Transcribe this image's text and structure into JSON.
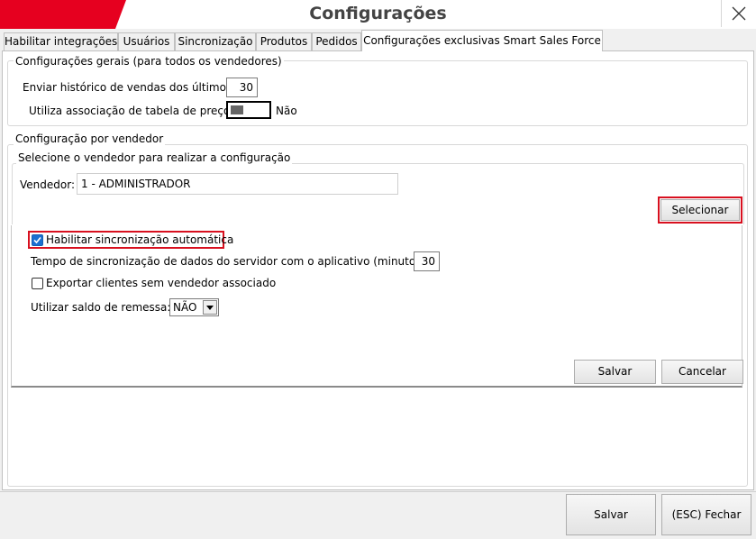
{
  "window": {
    "title": "Configurações",
    "close_icon": "close-icon"
  },
  "tabs": [
    {
      "label": "Habilitar integrações"
    },
    {
      "label": "Usuários"
    },
    {
      "label": "Sincronização"
    },
    {
      "label": "Produtos"
    },
    {
      "label": "Pedidos"
    },
    {
      "label": "Configurações exclusivas Smart Sales Force",
      "active": true
    }
  ],
  "general": {
    "legend": "Configurações gerais (para todos os vendedores)",
    "history_label": "Enviar histórico de vendas dos últimos:",
    "history_value": "30",
    "price_table_label": "Utiliza associação de tabela de preço:",
    "price_table_state": "Não"
  },
  "per_seller": {
    "legend": "Configuração por vendedor",
    "select_legend": "Selecione o vendedor para realizar a configuração",
    "seller_label": "Vendedor:",
    "seller_value": "1 - ADMINISTRADOR",
    "select_button": "Selecionar",
    "auto_sync_label": "Habilitar sincronização automática",
    "auto_sync_checked": true,
    "sync_time_label": "Tempo de sincronização de dados do servidor com o aplicativo (minutos):",
    "sync_time_value": "30",
    "export_clients_label": "Exportar clientes sem vendedor associado",
    "export_clients_checked": false,
    "remessa_label": "Utilizar saldo de remessa:",
    "remessa_value": "NÃO",
    "save_button": "Salvar",
    "cancel_button": "Cancelar"
  },
  "footer": {
    "save_button": "Salvar",
    "close_button": "(ESC) Fechar"
  },
  "colors": {
    "brand_red": "#e6001f",
    "highlight_red": "#d8101f",
    "checkbox_blue": "#1a6fd1"
  }
}
